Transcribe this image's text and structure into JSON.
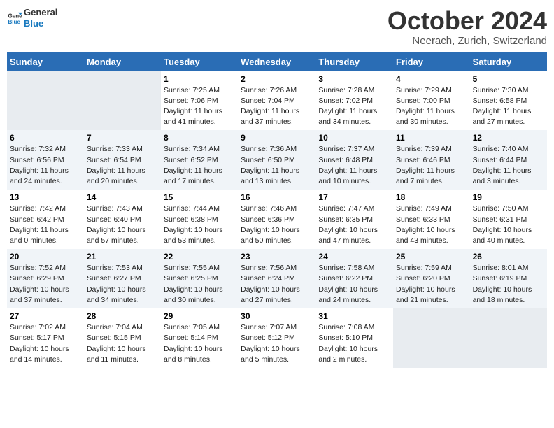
{
  "header": {
    "logo_line1": "General",
    "logo_line2": "Blue",
    "month": "October 2024",
    "location": "Neerach, Zurich, Switzerland"
  },
  "days_of_week": [
    "Sunday",
    "Monday",
    "Tuesday",
    "Wednesday",
    "Thursday",
    "Friday",
    "Saturday"
  ],
  "weeks": [
    [
      {
        "num": "",
        "info": ""
      },
      {
        "num": "",
        "info": ""
      },
      {
        "num": "1",
        "info": "Sunrise: 7:25 AM\nSunset: 7:06 PM\nDaylight: 11 hours and 41 minutes."
      },
      {
        "num": "2",
        "info": "Sunrise: 7:26 AM\nSunset: 7:04 PM\nDaylight: 11 hours and 37 minutes."
      },
      {
        "num": "3",
        "info": "Sunrise: 7:28 AM\nSunset: 7:02 PM\nDaylight: 11 hours and 34 minutes."
      },
      {
        "num": "4",
        "info": "Sunrise: 7:29 AM\nSunset: 7:00 PM\nDaylight: 11 hours and 30 minutes."
      },
      {
        "num": "5",
        "info": "Sunrise: 7:30 AM\nSunset: 6:58 PM\nDaylight: 11 hours and 27 minutes."
      }
    ],
    [
      {
        "num": "6",
        "info": "Sunrise: 7:32 AM\nSunset: 6:56 PM\nDaylight: 11 hours and 24 minutes."
      },
      {
        "num": "7",
        "info": "Sunrise: 7:33 AM\nSunset: 6:54 PM\nDaylight: 11 hours and 20 minutes."
      },
      {
        "num": "8",
        "info": "Sunrise: 7:34 AM\nSunset: 6:52 PM\nDaylight: 11 hours and 17 minutes."
      },
      {
        "num": "9",
        "info": "Sunrise: 7:36 AM\nSunset: 6:50 PM\nDaylight: 11 hours and 13 minutes."
      },
      {
        "num": "10",
        "info": "Sunrise: 7:37 AM\nSunset: 6:48 PM\nDaylight: 11 hours and 10 minutes."
      },
      {
        "num": "11",
        "info": "Sunrise: 7:39 AM\nSunset: 6:46 PM\nDaylight: 11 hours and 7 minutes."
      },
      {
        "num": "12",
        "info": "Sunrise: 7:40 AM\nSunset: 6:44 PM\nDaylight: 11 hours and 3 minutes."
      }
    ],
    [
      {
        "num": "13",
        "info": "Sunrise: 7:42 AM\nSunset: 6:42 PM\nDaylight: 11 hours and 0 minutes."
      },
      {
        "num": "14",
        "info": "Sunrise: 7:43 AM\nSunset: 6:40 PM\nDaylight: 10 hours and 57 minutes."
      },
      {
        "num": "15",
        "info": "Sunrise: 7:44 AM\nSunset: 6:38 PM\nDaylight: 10 hours and 53 minutes."
      },
      {
        "num": "16",
        "info": "Sunrise: 7:46 AM\nSunset: 6:36 PM\nDaylight: 10 hours and 50 minutes."
      },
      {
        "num": "17",
        "info": "Sunrise: 7:47 AM\nSunset: 6:35 PM\nDaylight: 10 hours and 47 minutes."
      },
      {
        "num": "18",
        "info": "Sunrise: 7:49 AM\nSunset: 6:33 PM\nDaylight: 10 hours and 43 minutes."
      },
      {
        "num": "19",
        "info": "Sunrise: 7:50 AM\nSunset: 6:31 PM\nDaylight: 10 hours and 40 minutes."
      }
    ],
    [
      {
        "num": "20",
        "info": "Sunrise: 7:52 AM\nSunset: 6:29 PM\nDaylight: 10 hours and 37 minutes."
      },
      {
        "num": "21",
        "info": "Sunrise: 7:53 AM\nSunset: 6:27 PM\nDaylight: 10 hours and 34 minutes."
      },
      {
        "num": "22",
        "info": "Sunrise: 7:55 AM\nSunset: 6:25 PM\nDaylight: 10 hours and 30 minutes."
      },
      {
        "num": "23",
        "info": "Sunrise: 7:56 AM\nSunset: 6:24 PM\nDaylight: 10 hours and 27 minutes."
      },
      {
        "num": "24",
        "info": "Sunrise: 7:58 AM\nSunset: 6:22 PM\nDaylight: 10 hours and 24 minutes."
      },
      {
        "num": "25",
        "info": "Sunrise: 7:59 AM\nSunset: 6:20 PM\nDaylight: 10 hours and 21 minutes."
      },
      {
        "num": "26",
        "info": "Sunrise: 8:01 AM\nSunset: 6:19 PM\nDaylight: 10 hours and 18 minutes."
      }
    ],
    [
      {
        "num": "27",
        "info": "Sunrise: 7:02 AM\nSunset: 5:17 PM\nDaylight: 10 hours and 14 minutes."
      },
      {
        "num": "28",
        "info": "Sunrise: 7:04 AM\nSunset: 5:15 PM\nDaylight: 10 hours and 11 minutes."
      },
      {
        "num": "29",
        "info": "Sunrise: 7:05 AM\nSunset: 5:14 PM\nDaylight: 10 hours and 8 minutes."
      },
      {
        "num": "30",
        "info": "Sunrise: 7:07 AM\nSunset: 5:12 PM\nDaylight: 10 hours and 5 minutes."
      },
      {
        "num": "31",
        "info": "Sunrise: 7:08 AM\nSunset: 5:10 PM\nDaylight: 10 hours and 2 minutes."
      },
      {
        "num": "",
        "info": ""
      },
      {
        "num": "",
        "info": ""
      }
    ]
  ]
}
